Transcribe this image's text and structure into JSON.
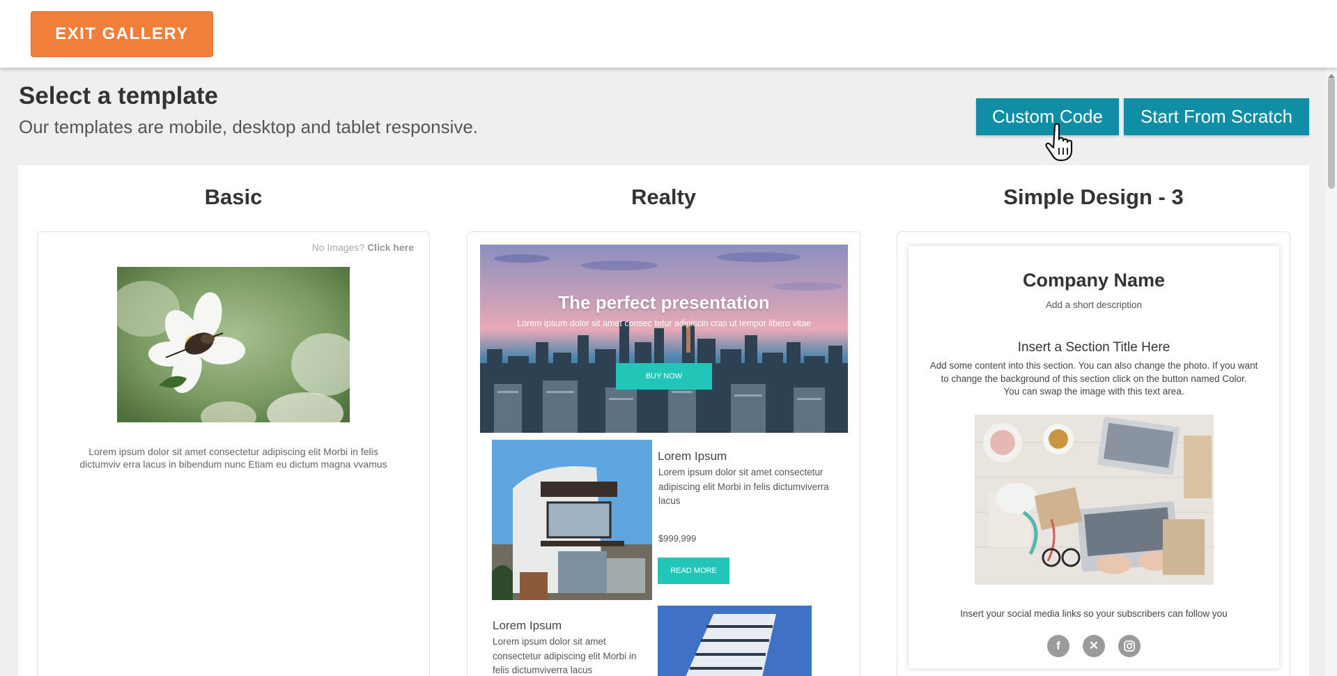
{
  "header": {
    "exit_label": "EXIT GALLERY"
  },
  "intro": {
    "title": "Select a template",
    "subtitle": "Our templates are mobile, desktop and tablet responsive."
  },
  "actions": {
    "custom_code": "Custom Code",
    "start_scratch": "Start From Scratch"
  },
  "templates": [
    {
      "name": "Basic",
      "no_images_prefix": "No Images?",
      "no_images_link": "Click here",
      "lorem_line1": "Lorem ipsum dolor sit amet consectetur adipiscing elit Morbi in felis",
      "lorem_line2": "dictumviv erra lacus in bibendum nunc Etiam eu dictum magna vvamus"
    },
    {
      "name": "Realty",
      "hero_title": "The perfect presentation",
      "hero_sub": "Lorem ipsum dolor sit amet consec tetur adipiscin cras ut tempor libero vitae",
      "buy_label": "BUY NOW",
      "listing1_title": "Lorem Ipsum",
      "listing1_line1": "Lorem ipsum dolor sit amet consectetur",
      "listing1_line2": "adipiscing elit Morbi in felis dictumviverra",
      "listing1_line3": "lacus",
      "price": "$999,999",
      "read_more": "READ MORE",
      "listing2_title": "Lorem Ipsum",
      "listing2_line1": "Lorem ipsum dolor sit amet",
      "listing2_line2": "consectetur adipiscing elit Morbi in",
      "listing2_line3": "felis dictumviverra lacus"
    },
    {
      "name": "Simple Design - 3",
      "company": "Company Name",
      "short_desc": "Add a short description",
      "section_title": "Insert a Section Title Here",
      "section_line1": "Add some content into this section. You can also change the photo. If you want",
      "section_line2": "to change the background of this section click on the button named Color.",
      "section_line3": "You can swap the image with this text area.",
      "social_text": "Insert your social media links so your subscribers can follow you",
      "social_icons": [
        "facebook-icon",
        "x-icon",
        "instagram-icon"
      ]
    }
  ],
  "colors": {
    "accent_orange": "#f07f3c",
    "accent_teal": "#0f8ea5",
    "button_aqua": "#21c6b8"
  }
}
